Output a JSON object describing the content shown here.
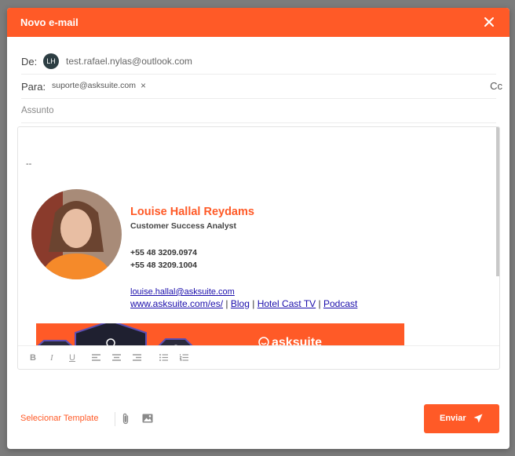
{
  "header": {
    "title": "Novo e-mail"
  },
  "from": {
    "label": "De:",
    "avatar_initials": "LH",
    "email": "test.rafael.nylas@outlook.com"
  },
  "to": {
    "label": "Para:",
    "chip_email": "suporte@asksuite.com",
    "chip_remove": "×",
    "cc_label": "Cc"
  },
  "subject": {
    "placeholder": "Assunto"
  },
  "signature": {
    "separator": "--",
    "name": "Louise Hallal Reydams",
    "role": "Customer Success Analyst",
    "phone1": "+55 48 3209.0974",
    "phone2": "+55 48 3209.1004",
    "email": "louise.hallal@asksuite.com",
    "links": [
      {
        "text": "www.asksuite.com/es/"
      },
      {
        "text": "Blog"
      },
      {
        "text": "Hotel Cast TV"
      },
      {
        "text": "Podcast"
      }
    ],
    "link_separator": "|",
    "banner_brand": "asksuite"
  },
  "toolbar": {
    "bold": "B",
    "italic": "I",
    "underline": "U"
  },
  "footer": {
    "template_label": "Selecionar Template",
    "send_label": "Enviar"
  },
  "colors": {
    "accent": "#ff5a27",
    "link": "#1a0dab",
    "avatar_bg": "#2d3e43"
  }
}
